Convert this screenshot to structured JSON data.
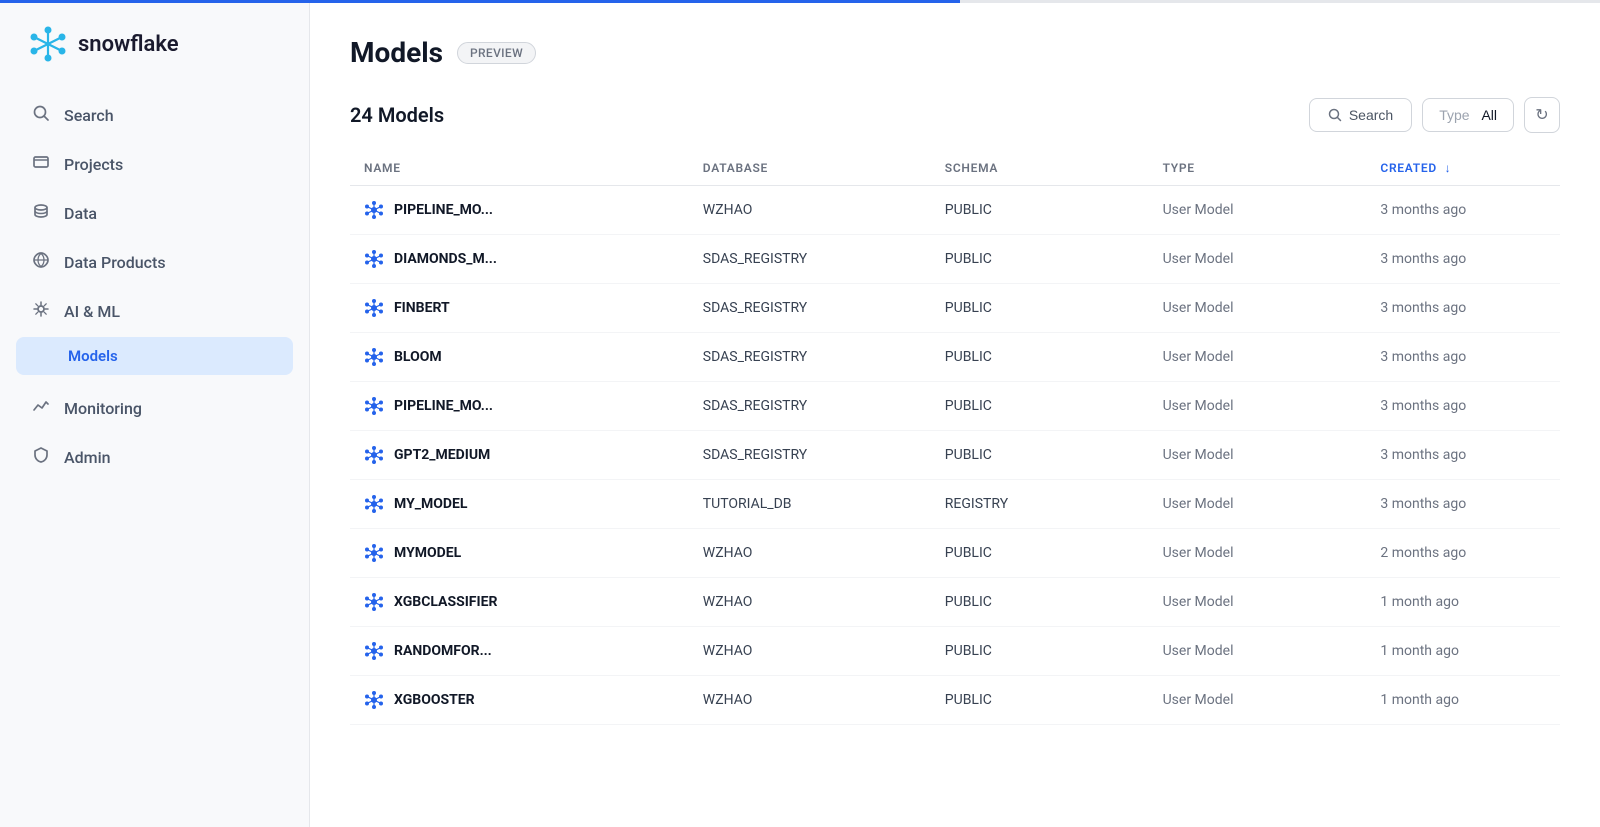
{
  "sidebar": {
    "logo_text": "snowflake",
    "nav_items": [
      {
        "id": "search",
        "label": "Search",
        "icon": "🔍"
      },
      {
        "id": "projects",
        "label": "Projects",
        "icon": "🖥"
      },
      {
        "id": "data",
        "label": "Data",
        "icon": "🗄"
      },
      {
        "id": "data-products",
        "label": "Data Products",
        "icon": "☁"
      },
      {
        "id": "ai-ml",
        "label": "AI & ML",
        "icon": "✦"
      }
    ],
    "sub_nav": [
      {
        "id": "models",
        "label": "Models"
      }
    ],
    "bottom_nav": [
      {
        "id": "monitoring",
        "label": "Monitoring",
        "icon": "📈"
      },
      {
        "id": "admin",
        "label": "Admin",
        "icon": "🛡"
      }
    ]
  },
  "page": {
    "title": "Models",
    "badge": "PREVIEW",
    "models_count": "24 Models"
  },
  "toolbar": {
    "search_placeholder": "Search",
    "type_label": "Type",
    "type_value": "All",
    "refresh_icon": "↻"
  },
  "table": {
    "columns": [
      {
        "id": "name",
        "label": "NAME",
        "sorted": false
      },
      {
        "id": "database",
        "label": "DATABASE",
        "sorted": false
      },
      {
        "id": "schema",
        "label": "SCHEMA",
        "sorted": false
      },
      {
        "id": "type",
        "label": "TYPE",
        "sorted": false
      },
      {
        "id": "created",
        "label": "CREATED",
        "sorted": true,
        "direction": "↓"
      }
    ],
    "rows": [
      {
        "name": "PIPELINE_MO...",
        "database": "WZHAO",
        "schema": "PUBLIC",
        "type": "User Model",
        "created": "3 months ago"
      },
      {
        "name": "DIAMONDS_M...",
        "database": "SDAS_REGISTRY",
        "schema": "PUBLIC",
        "type": "User Model",
        "created": "3 months ago"
      },
      {
        "name": "FINBERT",
        "database": "SDAS_REGISTRY",
        "schema": "PUBLIC",
        "type": "User Model",
        "created": "3 months ago"
      },
      {
        "name": "BLOOM",
        "database": "SDAS_REGISTRY",
        "schema": "PUBLIC",
        "type": "User Model",
        "created": "3 months ago"
      },
      {
        "name": "PIPELINE_MO...",
        "database": "SDAS_REGISTRY",
        "schema": "PUBLIC",
        "type": "User Model",
        "created": "3 months ago"
      },
      {
        "name": "GPT2_MEDIUM",
        "database": "SDAS_REGISTRY",
        "schema": "PUBLIC",
        "type": "User Model",
        "created": "3 months ago"
      },
      {
        "name": "MY_MODEL",
        "database": "TUTORIAL_DB",
        "schema": "REGISTRY",
        "type": "User Model",
        "created": "3 months ago"
      },
      {
        "name": "MYMODEL",
        "database": "WZHAO",
        "schema": "PUBLIC",
        "type": "User Model",
        "created": "2 months ago"
      },
      {
        "name": "XGBCLASSIFIER",
        "database": "WZHAO",
        "schema": "PUBLIC",
        "type": "User Model",
        "created": "1 month ago"
      },
      {
        "name": "RANDOMFOR...",
        "database": "WZHAO",
        "schema": "PUBLIC",
        "type": "User Model",
        "created": "1 month ago"
      },
      {
        "name": "XGBOOSTER",
        "database": "WZHAO",
        "schema": "PUBLIC",
        "type": "User Model",
        "created": "1 month ago"
      }
    ]
  }
}
